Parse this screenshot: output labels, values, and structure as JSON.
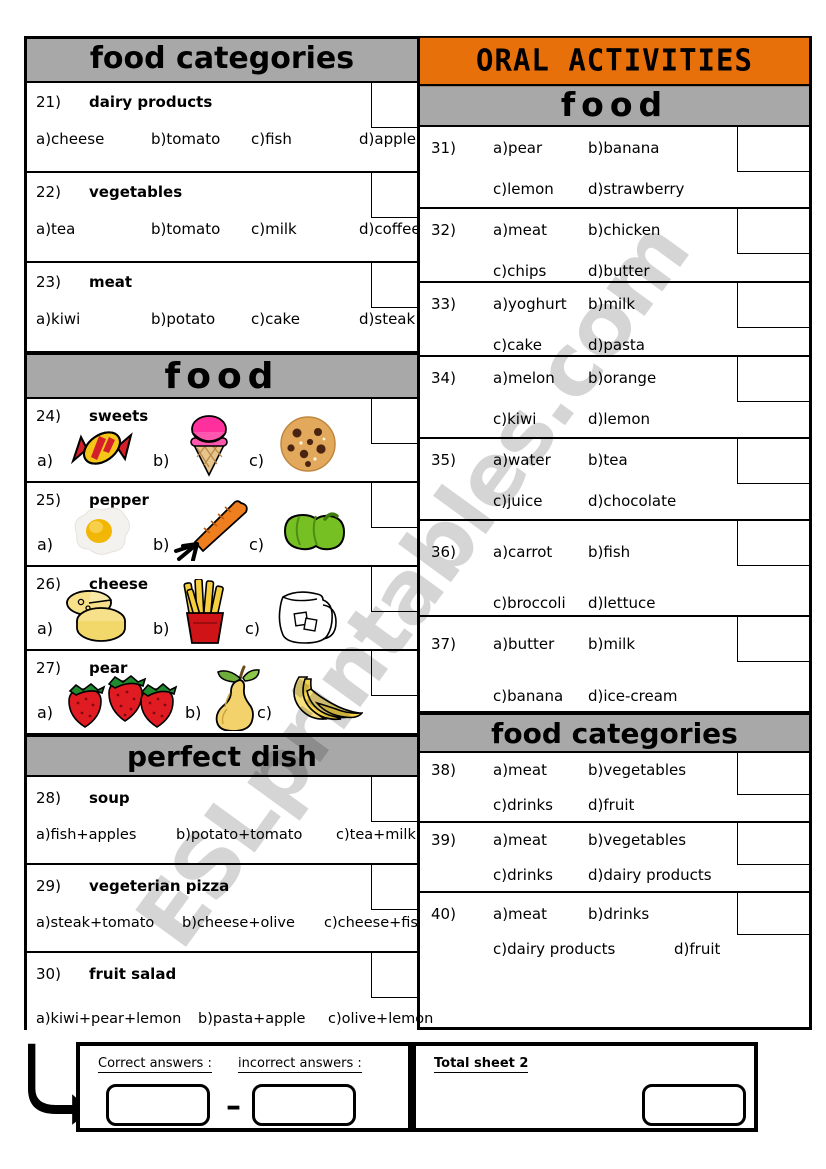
{
  "watermark": "ESLprintables.com",
  "colors": {
    "gray": "#a8a8a8",
    "orange": "#e8700a",
    "border": "#000000"
  },
  "left_column": {
    "banners": {
      "food_categories": "food categories",
      "food": "food",
      "perfect_dish": "perfect dish"
    },
    "questions_text": [
      {
        "num": "21)",
        "title": "dairy products",
        "options": [
          "a)cheese",
          "b)tomato",
          "c)fish",
          "d)apple"
        ]
      },
      {
        "num": "22)",
        "title": "vegetables",
        "options": [
          "a)tea",
          "b)tomato",
          "c)milk",
          "d)coffee"
        ]
      },
      {
        "num": "23)",
        "title": "meat",
        "options": [
          "a)kiwi",
          "b)potato",
          "c)cake",
          "d)steak"
        ]
      }
    ],
    "questions_picture": [
      {
        "num": "24)",
        "title": "sweets",
        "options": [
          {
            "label": "a)",
            "icon": "candy-icon"
          },
          {
            "label": "b)",
            "icon": "ice-cream-cone-icon"
          },
          {
            "label": "c)",
            "icon": "cookie-icon"
          }
        ]
      },
      {
        "num": "25)",
        "title": "pepper",
        "options": [
          {
            "label": "a)",
            "icon": "fried-egg-icon"
          },
          {
            "label": "b)",
            "icon": "carrot-icon"
          },
          {
            "label": "c)",
            "icon": "green-pepper-icon"
          }
        ]
      },
      {
        "num": "26)",
        "title": "cheese",
        "options": [
          {
            "label": "a)",
            "icon": "cheese-wheel-icon"
          },
          {
            "label": "b)",
            "icon": "french-fries-icon"
          },
          {
            "label": "c)",
            "icon": "water-jug-icon"
          }
        ]
      },
      {
        "num": "27)",
        "title": "pear",
        "options": [
          {
            "label": "a)",
            "icon": "strawberries-icon"
          },
          {
            "label": "b)",
            "icon": "pear-icon"
          },
          {
            "label": "c)",
            "icon": "banana-icon"
          }
        ]
      }
    ],
    "questions_dish": [
      {
        "num": "28)",
        "title": "soup",
        "options": [
          "a)fish+apples",
          "b)potato+tomato",
          "c)tea+milk"
        ]
      },
      {
        "num": "29)",
        "title": "vegeterian pizza",
        "options": [
          "a)steak+tomato",
          "b)cheese+olive",
          "c)cheese+fish"
        ]
      },
      {
        "num": "30)",
        "title": "fruit salad",
        "options": [
          "a)kiwi+pear+lemon",
          "b)pasta+apple",
          "c)olive+lemon"
        ]
      }
    ]
  },
  "right_column": {
    "banners": {
      "oral_activities": "ORAL ACTIVITIES",
      "food": "food",
      "food_categories": "food categories"
    },
    "questions_food": [
      {
        "num": "31)",
        "a": "a)pear",
        "b": "b)banana",
        "c": "c)lemon",
        "d": "d)strawberry"
      },
      {
        "num": "32)",
        "a": "a)meat",
        "b": "b)chicken",
        "c": "c)chips",
        "d": "d)butter"
      },
      {
        "num": "33)",
        "a": "a)yoghurt",
        "b": "b)milk",
        "c": "c)cake",
        "d": "d)pasta"
      },
      {
        "num": "34)",
        "a": "a)melon",
        "b": "b)orange",
        "c": "c)kiwi",
        "d": "d)lemon"
      },
      {
        "num": "35)",
        "a": "a)water",
        "b": "b)tea",
        "c": "c)juice",
        "d": "d)chocolate"
      },
      {
        "num": "36)",
        "a": "a)carrot",
        "b": "b)fish",
        "c": "c)broccoli",
        "d": "d)lettuce"
      },
      {
        "num": "37)",
        "a": "a)butter",
        "b": "b)milk",
        "c": "c)banana",
        "d": "d)ice-cream"
      }
    ],
    "questions_categories": [
      {
        "num": "38)",
        "a": "a)meat",
        "b": "b)vegetables",
        "c": "c)drinks",
        "d": "d)fruit"
      },
      {
        "num": "39)",
        "a": "a)meat",
        "b": "b)vegetables",
        "c": "c)drinks",
        "d": "d)dairy products"
      },
      {
        "num": "40)",
        "a": "a)meat",
        "b": "b)drinks",
        "c": "c)dairy products",
        "d": "d)fruit"
      }
    ]
  },
  "footer": {
    "correct_label": "Correct answers :",
    "incorrect_label": "incorrect answers :",
    "total_label": "Total sheet 2",
    "minus_sign": "–",
    "correct_value": "",
    "incorrect_value": "",
    "total_value": ""
  }
}
